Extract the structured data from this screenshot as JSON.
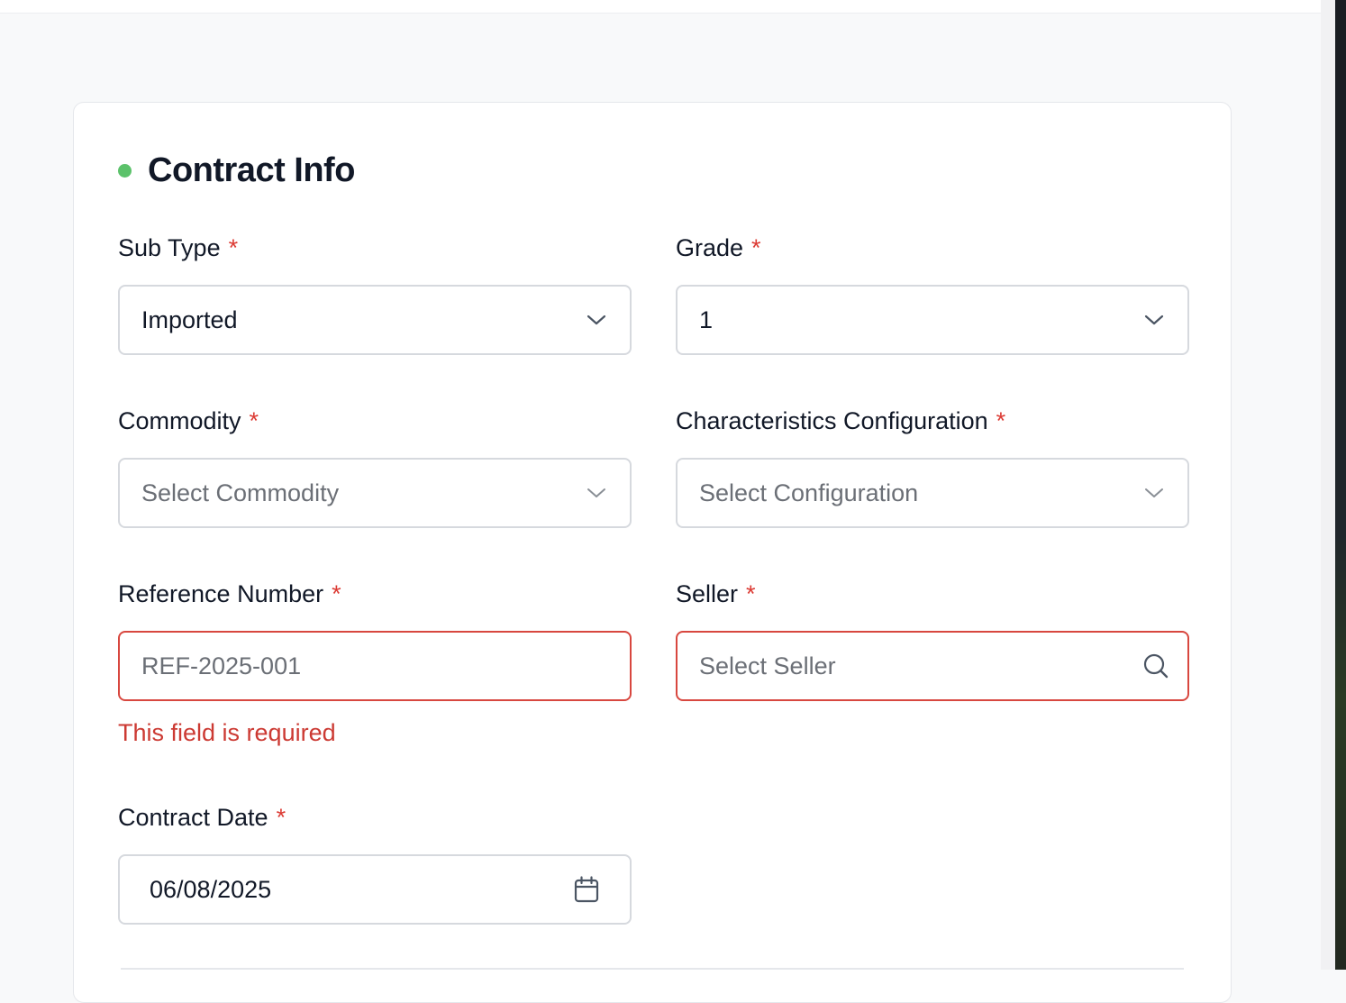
{
  "section": {
    "title": "Contract Info"
  },
  "fields": {
    "sub_type": {
      "label": "Sub Type",
      "required_mark": "*",
      "value": "Imported"
    },
    "grade": {
      "label": "Grade",
      "required_mark": "*",
      "value": "1"
    },
    "commodity": {
      "label": "Commodity",
      "required_mark": "*",
      "placeholder": "Select Commodity"
    },
    "characteristics_configuration": {
      "label": "Characteristics Configuration",
      "required_mark": "*",
      "placeholder": "Select Configuration"
    },
    "reference_number": {
      "label": "Reference Number",
      "required_mark": "*",
      "placeholder": "REF-2025-001",
      "error": "This field is required"
    },
    "seller": {
      "label": "Seller",
      "required_mark": "*",
      "placeholder": "Select Seller"
    },
    "contract_date": {
      "label": "Contract Date",
      "required_mark": "*",
      "value": "06/08/2025"
    }
  },
  "icons": {
    "dropdown": "chevron-down-icon",
    "search": "search-icon",
    "calendar": "calendar-icon"
  },
  "colors": {
    "accent_dot": "#5cc26b",
    "required": "#dc3b34",
    "error": "#d8473f",
    "placeholder": "#6b6f76",
    "text": "#111827"
  }
}
